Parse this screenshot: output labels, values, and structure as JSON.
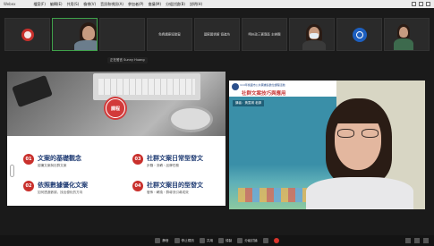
{
  "menubar": {
    "title": "Webex",
    "items": [
      "檔案(F)",
      "編輯(E)",
      "共用(S)",
      "檢視(V)",
      "音訊和視訊(A)",
      "參加者(P)",
      "會議(M)",
      "分組討論(B)",
      "說明(H)"
    ]
  },
  "thumbnails": [
    {
      "name": "",
      "tag": ""
    },
    {
      "name": "",
      "tag": ""
    },
    {
      "name": "",
      "tag": ""
    },
    {
      "name": "免費講座協助窗",
      "tag": ""
    },
    {
      "name": "國家圖書館 協進坊",
      "tag": ""
    },
    {
      "name": "明州政三寶專區 主辦團",
      "tag": ""
    },
    {
      "name": "",
      "tag": ""
    },
    {
      "name": "",
      "tag": ""
    },
    {
      "name": "",
      "tag": ""
    }
  ],
  "speaking_label": "正在發言 Sunny Huang",
  "slide": {
    "badge": "課程",
    "items": [
      {
        "num": "01",
        "title": "文案的基礎觀念",
        "sub": "認識文案與社群文案"
      },
      {
        "num": "02",
        "title": "依照數據優化文案",
        "sub": "如何透過數據，找出優化的方向"
      },
      {
        "num": "03",
        "title": "社群文案日常型發文",
        "sub": "步驟・流轉・品牌任務"
      },
      {
        "num": "04",
        "title": "社群文案目的型發文",
        "sub": "發佈・轉換・群導流引導成效"
      }
    ]
  },
  "ppt": {
    "org": "110年桃園市公共圖書館數位課程活動",
    "title": "社群文案技巧與應用",
    "speaker": "講者：黃雯琪 老師"
  },
  "toolbar": {
    "buttons": [
      "靜音",
      "停止視訊",
      "共用",
      "錄製",
      "分組討論",
      "結束"
    ]
  }
}
